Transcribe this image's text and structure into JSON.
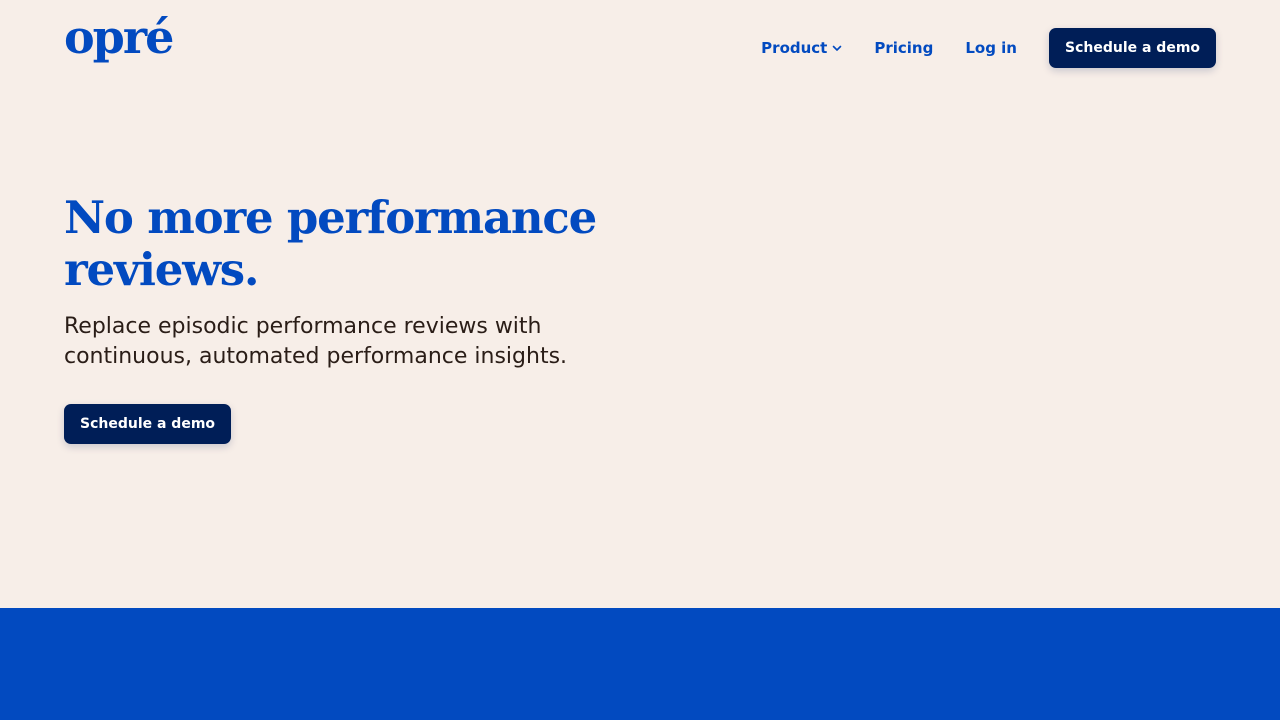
{
  "colors": {
    "background": "#f7eee8",
    "brand_blue": "#024ac0",
    "button_navy": "#001e57",
    "body_text": "#2a1d17"
  },
  "header": {
    "logo_text": "opré",
    "nav": {
      "product_label": "Product",
      "product_icon": "chevron-down-icon",
      "pricing_label": "Pricing",
      "login_label": "Log in",
      "cta_label": "Schedule a demo"
    }
  },
  "hero": {
    "title": "No more performance reviews.",
    "subtitle": "Replace episodic performance reviews with continuous, automated performance insights.",
    "cta_label": "Schedule a demo"
  }
}
